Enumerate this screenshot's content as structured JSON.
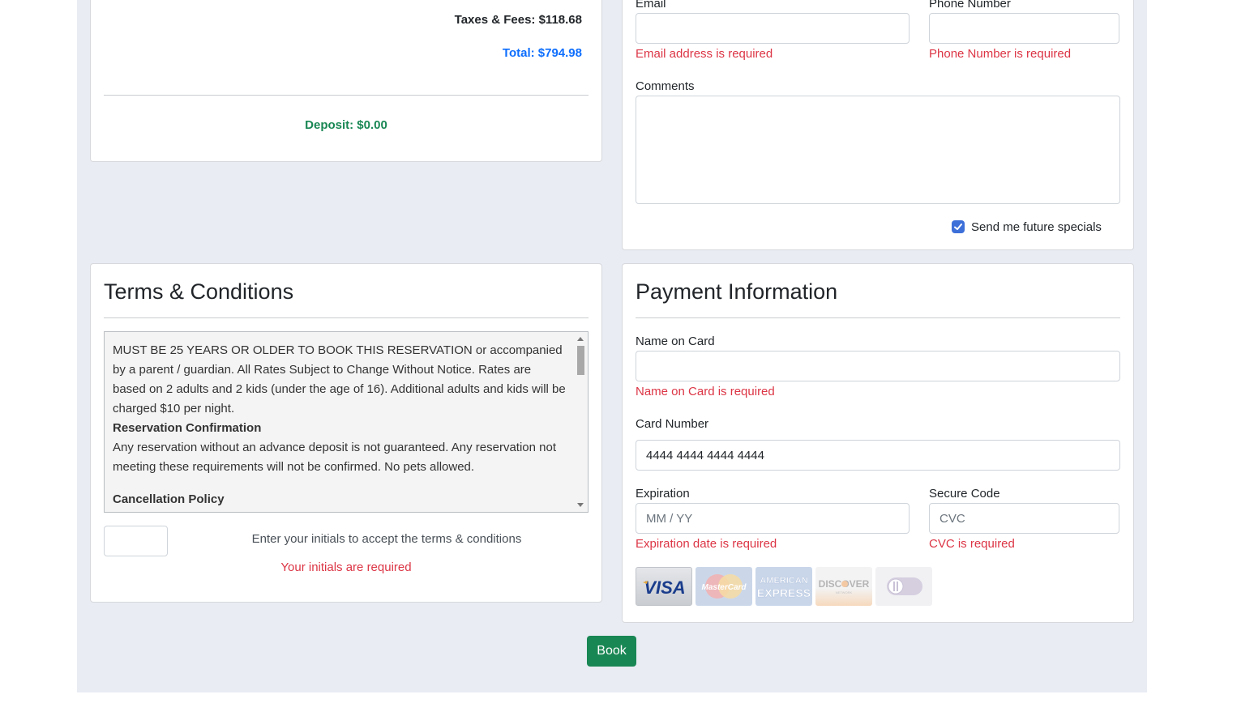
{
  "summary": {
    "taxes_fees": "Taxes & Fees: $118.68",
    "total": "Total: $794.98",
    "deposit": "Deposit: $0.00"
  },
  "contact": {
    "email_label": "Email",
    "email_value": "",
    "email_error": "Email address is required",
    "phone_label": "Phone Number",
    "phone_value": "",
    "phone_error": "Phone Number is required",
    "comments_label": "Comments",
    "comments_value": "",
    "specials_label": "Send me future specials",
    "specials_checked": true
  },
  "terms": {
    "heading": "Terms & Conditions",
    "intro": "MUST BE 25 YEARS OR OLDER TO BOOK THIS RESERVATION or accompanied by a parent / guardian. All Rates Subject to Change Without Notice. Rates are based on 2 adults and 2 kids (under the age of 16). Additional adults and kids will be charged $10 per night.",
    "confirmation_title": "Reservation Confirmation",
    "confirmation_text": "Any reservation without an advance deposit is not guaranteed. Any reservation not meeting these requirements will not be confirmed. No pets allowed.",
    "cancellation_title": "Cancellation Policy",
    "initials_value": "",
    "initials_prompt": "Enter your initials to accept the terms & conditions",
    "initials_error": "Your initials are required"
  },
  "payment": {
    "heading": "Payment Information",
    "name_label": "Name on Card",
    "name_value": "",
    "name_error": "Name on Card is required",
    "number_label": "Card Number",
    "number_value": "4444 4444 4444 4444",
    "expiration_label": "Expiration",
    "expiration_placeholder": "MM / YY",
    "expiration_error": "Expiration date is required",
    "cvc_label": "Secure Code",
    "cvc_placeholder": "CVC",
    "cvc_error": "CVC is required",
    "card_brands": [
      "VISA",
      "MasterCard",
      "AMERICAN EXPRESS",
      "DISCOVER",
      "Diners Club"
    ],
    "active_brand": "VISA"
  },
  "actions": {
    "book_label": "Book"
  },
  "colors": {
    "error": "#dc3545",
    "total": "#0d6efd",
    "deposit": "#198754",
    "book_button": "#198754",
    "page_background": "#e9ecf3"
  }
}
